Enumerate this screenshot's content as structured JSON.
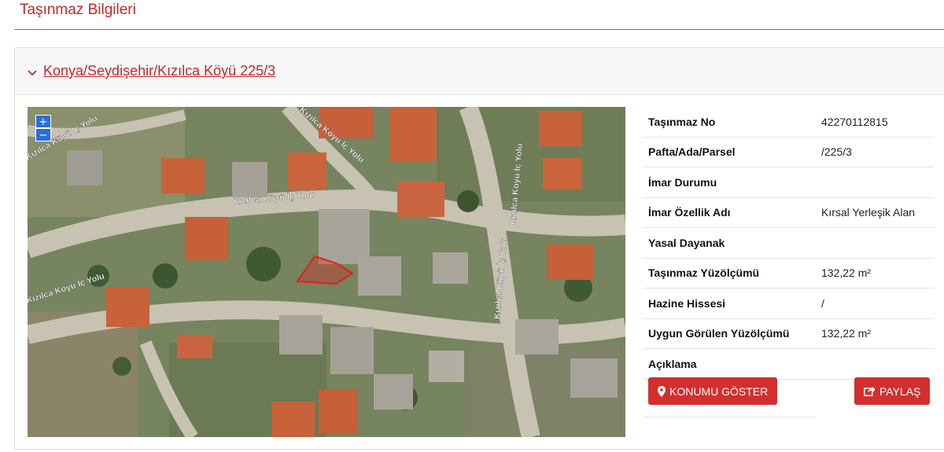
{
  "page": {
    "title": "Taşınmaz Bilgileri"
  },
  "panel": {
    "link_text": "Konya/Seydişehir/Kızılca Köyü 225/3"
  },
  "map": {
    "zoom_in": "+",
    "zoom_out": "−",
    "road_labels": [
      "Kızılca Köyü İç Yolu",
      "Kızılca Köyü İç Yolu",
      "Kızılca Köyü İç Yolu",
      "Kızılca Köyü İç Yolu",
      "Kızılca Köyü İç Yolu",
      "Kızılca Köyü İç Yolu"
    ]
  },
  "info": {
    "rows": [
      {
        "label": "Taşınmaz No",
        "value": "42270112815"
      },
      {
        "label": "Pafta/Ada/Parsel",
        "value": "/225/3"
      },
      {
        "label": "İmar Durumu",
        "value": ""
      },
      {
        "label": "İmar Özellik Adı",
        "value": "Kırsal Yerleşik Alan"
      },
      {
        "label": "Yasal Dayanak",
        "value": ""
      },
      {
        "label": "Taşınmaz Yüzölçümü",
        "value": "132,22 m²"
      },
      {
        "label": "Hazine Hissesi",
        "value": "/"
      },
      {
        "label": "Uygun Görülen Yüzölçümü",
        "value": "132,22 m²"
      },
      {
        "label": "Açıklama",
        "value": ""
      }
    ]
  },
  "buttons": {
    "show_location": "KONUMU GÖSTER",
    "share": "PAYLAŞ"
  },
  "colors": {
    "accent": "#c62828",
    "button": "#d32f2f",
    "parcel": "#e02020"
  }
}
